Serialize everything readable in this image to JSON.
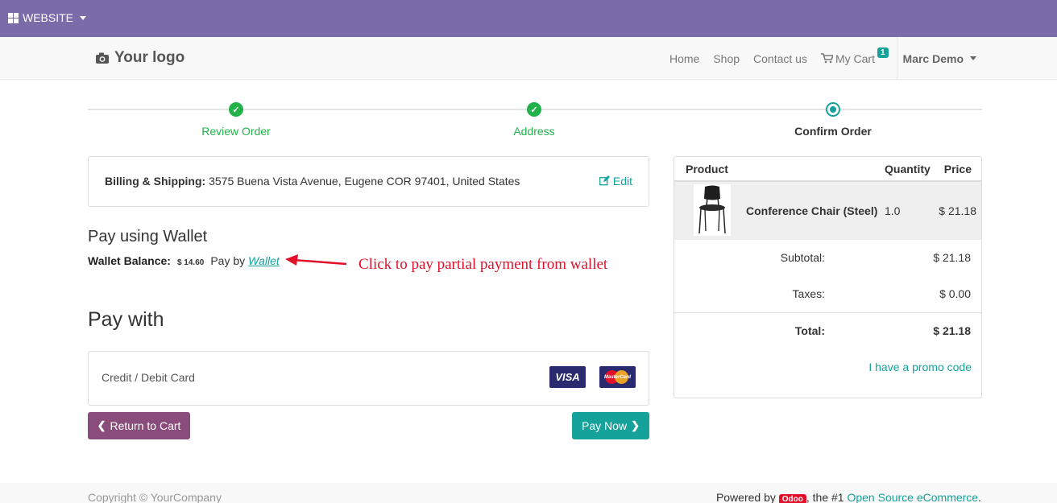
{
  "admin_bar": {
    "website_label": "WEBSITE"
  },
  "navbar": {
    "logo_text": "Your logo",
    "links": [
      "Home",
      "Shop",
      "Contact us"
    ],
    "cart_label": "My Cart",
    "cart_count": "1",
    "user_name": "Marc Demo"
  },
  "wizard": {
    "steps": [
      {
        "label": "Review Order",
        "state": "done"
      },
      {
        "label": "Address",
        "state": "done"
      },
      {
        "label": "Confirm Order",
        "state": "active"
      }
    ]
  },
  "billing": {
    "label": "Billing & Shipping:",
    "address": "3575 Buena Vista Avenue, Eugene COR 97401, United States",
    "edit_label": "Edit"
  },
  "wallet": {
    "heading": "Pay using Wallet",
    "balance_label": "Wallet Balance:",
    "balance_value": "$ 14.60",
    "pay_by_text": "Pay by",
    "link_text": "Wallet"
  },
  "annotation": {
    "text": "Click to pay partial payment from wallet"
  },
  "payment": {
    "heading": "Pay with",
    "acquirer": "Credit / Debit Card",
    "cards": [
      "VISA",
      "MasterCard"
    ]
  },
  "buttons": {
    "return_to_cart": "Return to Cart",
    "pay_now": "Pay Now"
  },
  "summary": {
    "headers": {
      "product": "Product",
      "quantity": "Quantity",
      "price": "Price"
    },
    "product": {
      "name": "Conference Chair (Steel)",
      "quantity": "1.0",
      "price": "$ 21.18"
    },
    "subtotal_label": "Subtotal:",
    "subtotal": "$ 21.18",
    "taxes_label": "Taxes:",
    "taxes": "$ 0.00",
    "total_label": "Total:",
    "total": "$ 21.18",
    "promo_label": "I have a promo code"
  },
  "footer": {
    "copyright": "Copyright © YourCompany",
    "powered_prefix": "Powered by",
    "odoo_badge": "Odoo",
    "powered_mid": ", the #1",
    "powered_link": "Open Source eCommerce",
    "powered_suffix": "."
  },
  "colors": {
    "admin_bar": "#7c6ba9",
    "accent": "#14a29a",
    "done_green": "#21b24a",
    "back_button": "#8a4d7b",
    "annotation": "#e3102a"
  }
}
